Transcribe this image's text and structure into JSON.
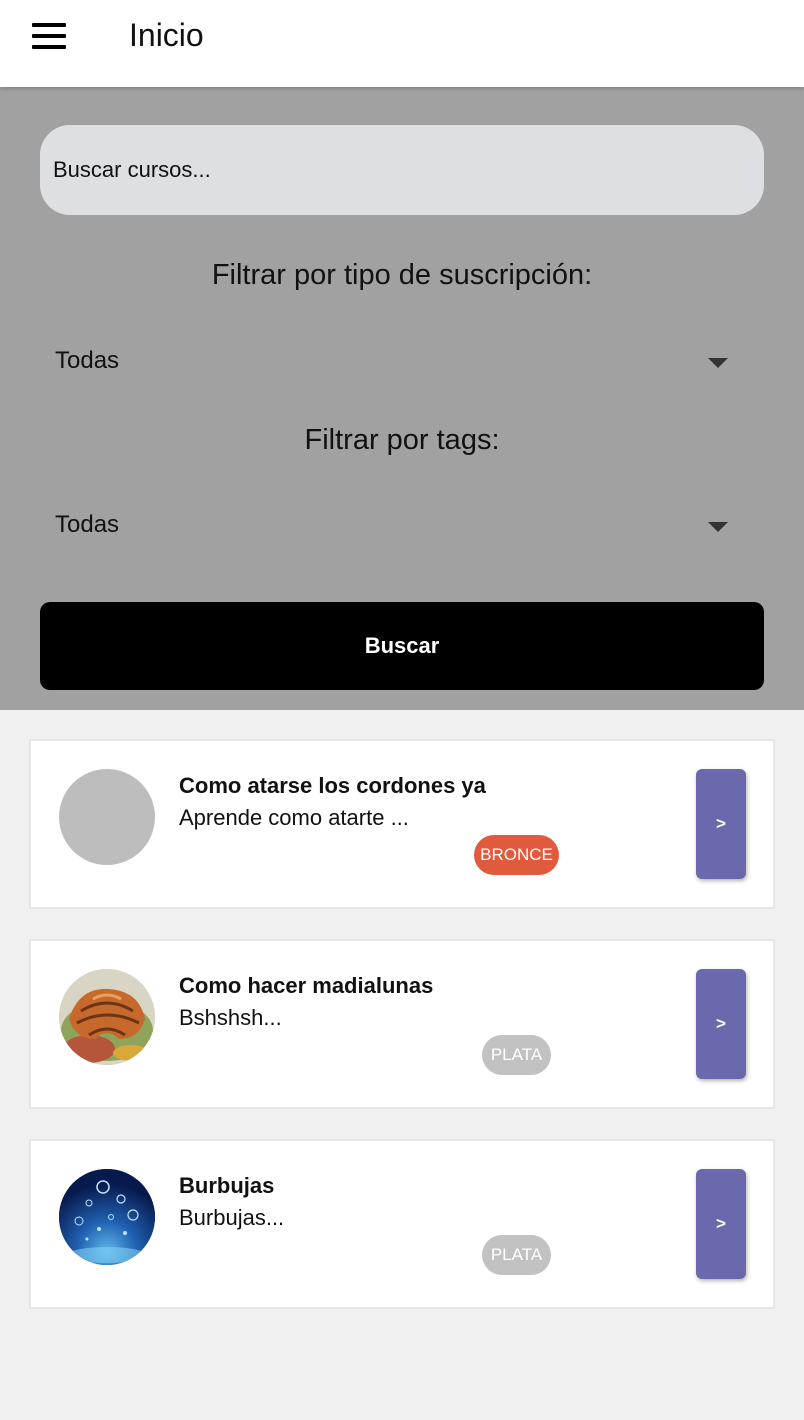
{
  "appbar": {
    "title": "Inicio",
    "menu_icon": "hamburger-menu-icon"
  },
  "filters": {
    "search_placeholder": "Buscar cursos...",
    "subscription_label": "Filtrar por tipo de suscripción:",
    "subscription_value": "Todas",
    "tags_label": "Filtrar por tags:",
    "tags_value": "Todas",
    "search_button": "Buscar"
  },
  "colors": {
    "panel": "#a1a1a1",
    "button_primary": "#000000",
    "go_button": "#6c68ad",
    "badge_bronce": "#e05a3d",
    "badge_plata": "#c2c2c2"
  },
  "courses": [
    {
      "title": "Como atarse los cordones ya",
      "description": "Aprende como atarte ...",
      "badge": "BRONCE",
      "thumbnail": "placeholder-gray",
      "go_label": ">"
    },
    {
      "title": "Como hacer madialunas",
      "description": "Bshshsh...",
      "badge": "PLATA",
      "thumbnail": "croissant",
      "go_label": ">"
    },
    {
      "title": "Burbujas",
      "description": "Burbujas...",
      "badge": "PLATA",
      "thumbnail": "bubbles",
      "go_label": ">"
    }
  ]
}
